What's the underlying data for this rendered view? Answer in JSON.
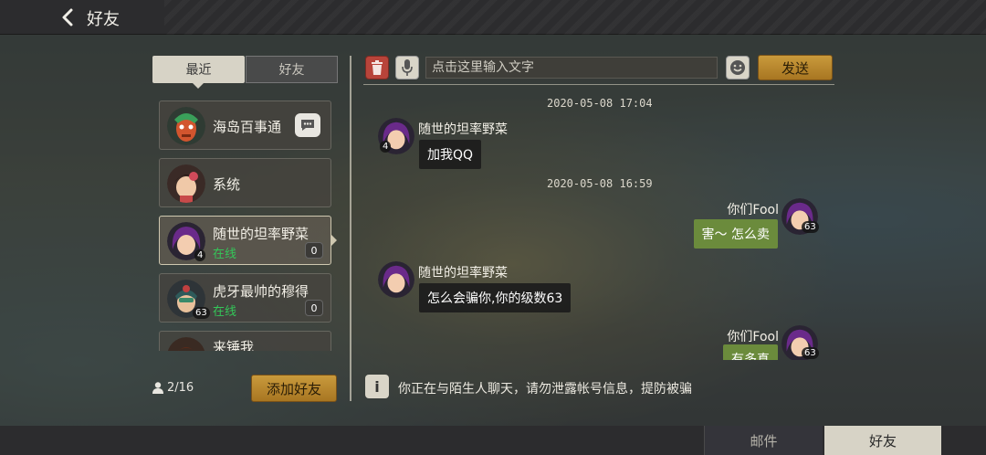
{
  "header": {
    "title": "好友"
  },
  "left_panel": {
    "tabs": [
      {
        "label": "最近",
        "active": true
      },
      {
        "label": "好友",
        "active": false
      }
    ],
    "contacts": [
      {
        "name": "海岛百事通",
        "status": "",
        "unread": "",
        "level": ""
      },
      {
        "name": "系统",
        "status": "",
        "unread": "",
        "level": ""
      },
      {
        "name": "随世的坦率野菜",
        "status": "在线",
        "unread": "0",
        "level": "4"
      },
      {
        "name": "虎牙最帅的穆得",
        "status": "在线",
        "unread": "0",
        "level": "63"
      },
      {
        "name": "来锤我",
        "status": "",
        "unread": "",
        "level": ""
      }
    ],
    "friend_count": "2/16",
    "add_friend_label": "添加好友"
  },
  "chat": {
    "input_placeholder": "点击这里输入文字",
    "send_label": "发送",
    "messages": [
      {
        "type": "timestamp",
        "text": "2020-05-08 17:04"
      },
      {
        "type": "incoming",
        "sender": "随世的坦率野菜",
        "text": "加我QQ",
        "level": "4"
      },
      {
        "type": "timestamp",
        "text": "2020-05-08 16:59"
      },
      {
        "type": "outgoing",
        "sender": "你们Fool",
        "text": "害～ 怎么卖",
        "level": "63"
      },
      {
        "type": "incoming",
        "sender": "随世的坦率野菜",
        "text": "怎么会骗你,你的级数63",
        "level": "4"
      },
      {
        "type": "outgoing",
        "sender": "你们Fool",
        "text": "有多真",
        "level": "63"
      }
    ],
    "notice": "你正在与陌生人聊天，请勿泄露帐号信息，提防被骗"
  },
  "bottom_tabs": [
    {
      "label": "邮件",
      "active": false
    },
    {
      "label": "好友",
      "active": true
    }
  ],
  "colors": {
    "accent_gold": "#c99a3c",
    "online_green": "#34c759",
    "outgoing_bubble": "#6b8b3c",
    "delete_red": "#b8443a"
  }
}
